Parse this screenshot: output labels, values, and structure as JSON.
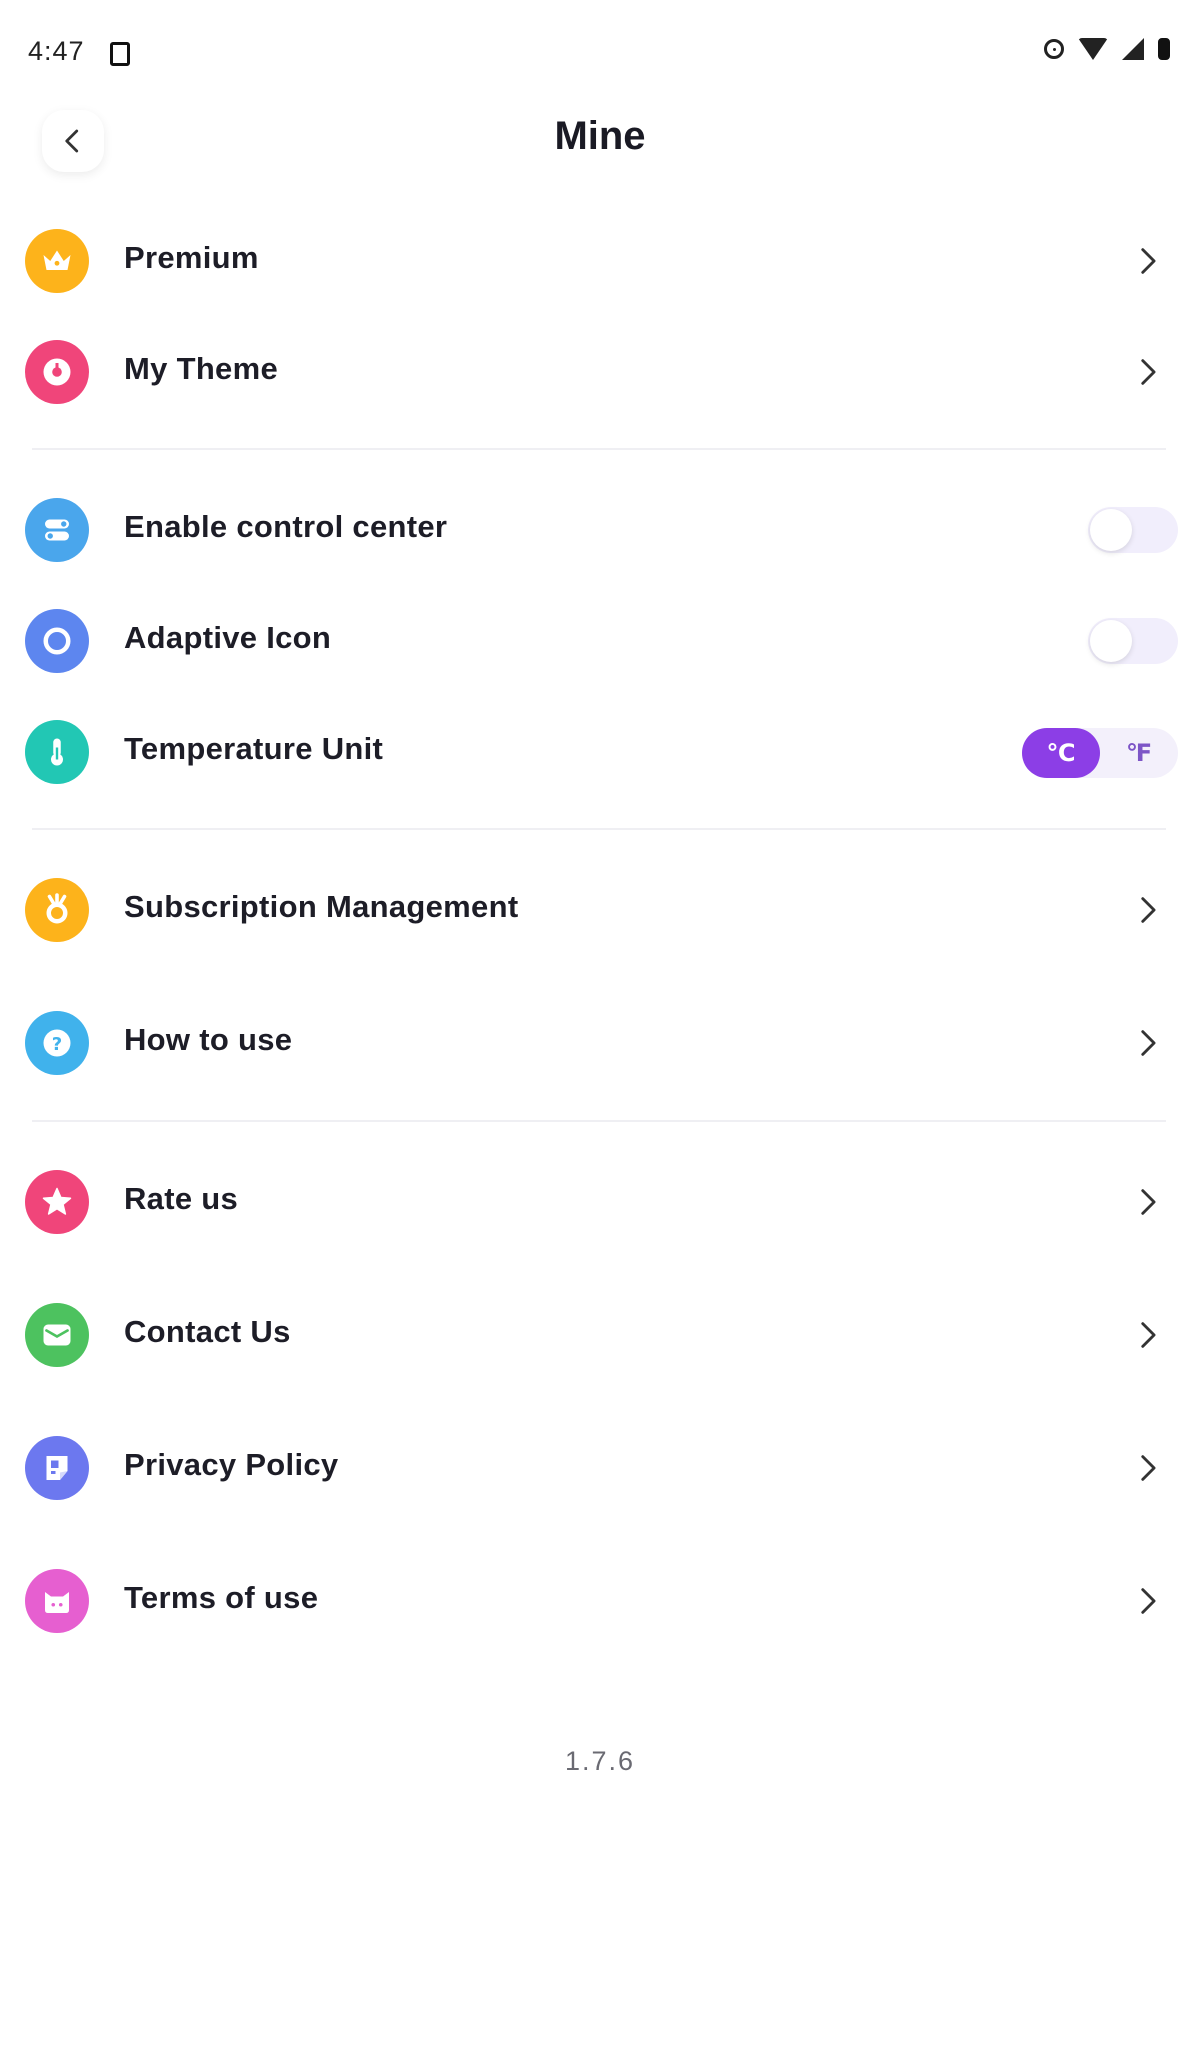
{
  "status_bar": {
    "time": "4:47",
    "icons": [
      "notification-icon",
      "do-not-disturb-icon",
      "wifi-icon",
      "cell-signal-icon",
      "battery-icon"
    ]
  },
  "header": {
    "title": "Mine",
    "back_icon": "chevron-left-icon"
  },
  "sections": {
    "account": [
      {
        "label": "Premium",
        "icon": "crown-icon",
        "color": "#fdb31b"
      },
      {
        "label": "My Theme",
        "icon": "palette-icon",
        "color": "#f0457a"
      }
    ],
    "settings": [
      {
        "label": "Enable control center",
        "icon": "toggle-icon",
        "color": "#4aa6ec",
        "toggle_on": false
      },
      {
        "label": "Adaptive Icon",
        "icon": "ring-icon",
        "color": "#5d86ef",
        "toggle_on": false
      },
      {
        "label": "Temperature Unit",
        "icon": "thermometer-icon",
        "color": "#22c7b4",
        "options": [
          "℃",
          "℉"
        ],
        "selected": "℃"
      }
    ],
    "support": [
      {
        "label": "Subscription Management",
        "icon": "subscription-icon",
        "color": "#fdb31b"
      },
      {
        "label": "How to use",
        "icon": "question-icon",
        "color": "#40b2ec"
      }
    ],
    "about": [
      {
        "label": "Rate us",
        "icon": "star-icon",
        "color": "#f0457a"
      },
      {
        "label": "Contact Us",
        "icon": "mail-icon",
        "color": "#4dc25f"
      },
      {
        "label": "Privacy Policy",
        "icon": "document-icon",
        "color": "#6c78ef"
      },
      {
        "label": "Terms of use",
        "icon": "terms-icon",
        "color": "#e65fd0"
      }
    ]
  },
  "footer": {
    "version": "1.7.6"
  }
}
